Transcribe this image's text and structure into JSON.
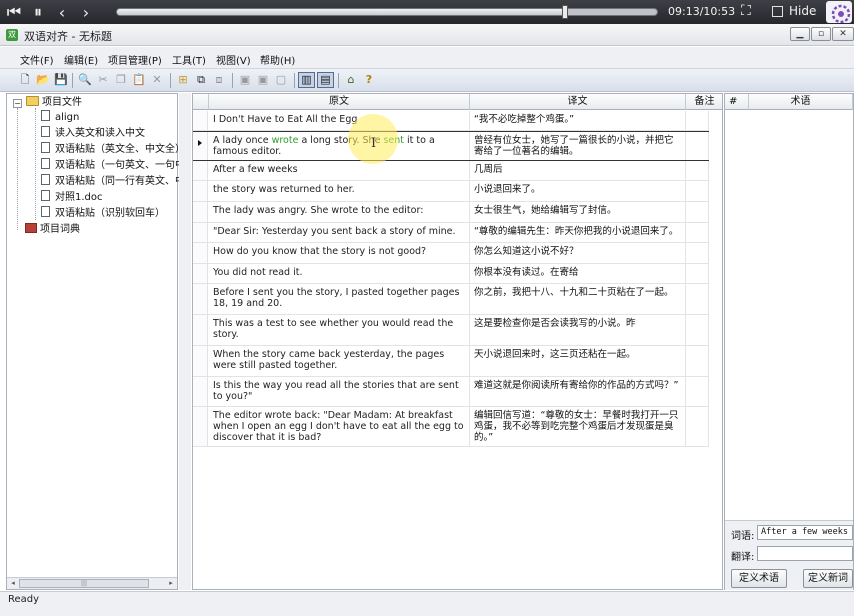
{
  "player": {
    "time": "09:13/10:53",
    "hide_label": "Hide",
    "progress": 0.83,
    "buttons": [
      "skip-back-icon",
      "pause-icon",
      "prev-icon",
      "next-icon",
      "fullscreen-icon"
    ]
  },
  "window": {
    "title": "双语对齐 - 无标题",
    "controls": [
      "minimize-icon",
      "maximize-icon",
      "close-icon"
    ]
  },
  "menu": {
    "items": [
      "文件(F)",
      "编辑(E)",
      "项目管理(P)",
      "工具(T)",
      "视图(V)",
      "帮助(H)"
    ]
  },
  "toolbar": {
    "icons": [
      "new-icon",
      "open-icon",
      "save-icon",
      "find-icon",
      "cut-icon",
      "copy-icon",
      "paste-icon",
      "delete-icon",
      "import-icon",
      "export-icon",
      "merge-icon",
      "split-up-icon",
      "split-down-icon",
      "split-icon",
      "view-parallel-icon",
      "view-stacked-icon",
      "home-icon",
      "help-icon"
    ]
  },
  "tree": {
    "root": "项目文件",
    "files": [
      "align",
      "读入英文和读入中文",
      "双语粘贴（英文全、中文全）",
      "双语粘贴（一句英文、一句中",
      "双语粘贴（同一行有英文、中",
      "对照1.doc",
      "双语粘贴（识别软回车）"
    ],
    "dictionary": "项目词典"
  },
  "grid": {
    "headers": {
      "source": "原文",
      "target": "译文",
      "note": "备注"
    },
    "rows": [
      {
        "source": "I Don't Have to Eat All the Egg",
        "target": "“我不必吃掉整个鸡蛋。”"
      },
      {
        "source_parts": [
          "A lady once ",
          "wrote",
          " a long story. She ",
          "sent",
          " it to a famous editor."
        ],
        "target": "曾经有位女士，她写了一篇很长的小说，并把它寄给了一位著名的编辑。"
      },
      {
        "source": "After a few weeks",
        "target": "几周后"
      },
      {
        "source": "the story was returned to her.",
        "target": "小说退回来了。"
      },
      {
        "source": "The lady was angry.  She wrote to the editor:",
        "target": "女士很生气，她给编辑写了封信。"
      },
      {
        "source": "\"Dear Sir: Yesterday you sent back a story of mine.",
        "target": "“尊敬的编辑先生：昨天你把我的小说退回来了。"
      },
      {
        "source": "How do you know that the story is not good?",
        "target": "你怎么知道这小说不好？"
      },
      {
        "source": "You did not read it.",
        "target": "你根本没有读过。在寄给"
      },
      {
        "source": "Before I sent you the story, I pasted together pages 18, 19 and 20.",
        "target": "你之前，我把十八、十九和二十页粘在了一起。"
      },
      {
        "source": "This was a test to see whether you would read the story.",
        "target": "这是要检查你是否会读我写的小说。昨"
      },
      {
        "source": "When  the story came back yesterday, the pages were still pasted together.",
        "target": "天小说退回来时，这三页还粘在一起。"
      },
      {
        "source": "Is this the way  you read all the stories that are sent to you?\"",
        "target": "难道这就是你阅读所有寄给你的作品的方式吗？”"
      },
      {
        "source": "The editor wrote back: \"Dear Madam: At breakfast when I open an egg I don't have  to eat all the egg to discover that it is bad?",
        "target": "编辑回信写道：“尊敬的女士：早餐时我打开一只鸡蛋，我不必等到吃完整个鸡蛋后才发现蛋是臭的。”"
      }
    ]
  },
  "terms": {
    "headers": {
      "index": "#",
      "term": "术语"
    },
    "term_label": "词语:",
    "term_value": "After a few weeks",
    "translation_label": "翻译:",
    "translation_value": "",
    "define_term_button": "定义术语",
    "define_new_word_button": "定义新词"
  },
  "status": {
    "text": "Ready"
  }
}
